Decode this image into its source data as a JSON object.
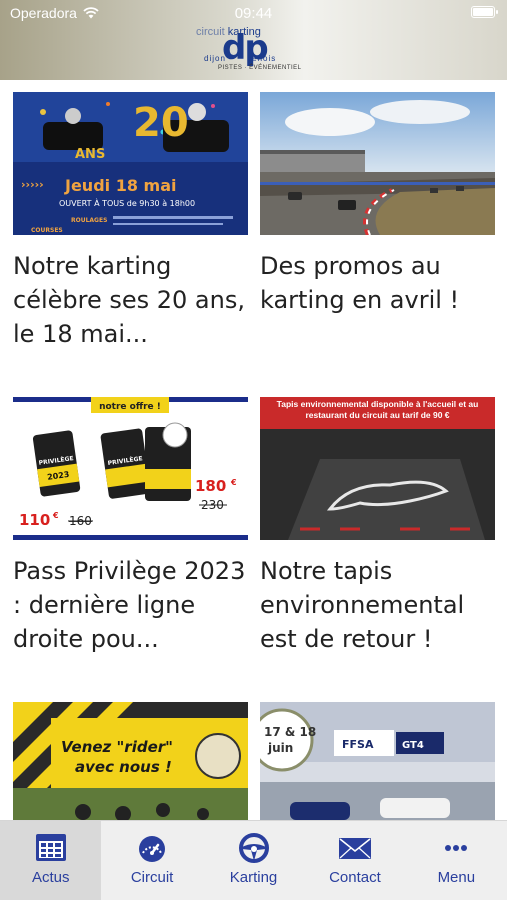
{
  "status_bar": {
    "carrier": "Operadora",
    "time": "09:44"
  },
  "logo": {
    "top_text_left": "circuit",
    "top_text_right": "karting",
    "monogram": "dp",
    "line_left": "dijon",
    "line_right": "renois",
    "tagline": "PISTES · ÉVÉNEMENTIEL"
  },
  "articles": [
    {
      "title": "Notre karting célèbre ses 20 ans, le 18 mai...",
      "image": {
        "big_text": "20",
        "ans_text": "ANS",
        "date_text": "Jeudi 18 mai",
        "hours_text": "OUVERT À TOUS de 9h30 à 18h00",
        "roulages": "ROULAGES",
        "courses": "COURSES"
      }
    },
    {
      "title": "Des promos au karting en avril !"
    },
    {
      "title": "Pass Privilège 2023 : dernière ligne droite pou...",
      "image": {
        "banner": "notre offre !",
        "price_new_1": "110",
        "price_old_1": "160",
        "price_new_2": "180",
        "price_old_2": "230",
        "currency": "€",
        "card_text": "PRIVILÈGE",
        "card_year": "2023"
      }
    },
    {
      "title": "Notre tapis environnemental est de retour !",
      "image": {
        "banner": "Tapis environnemental disponible à l'accueil et au restaurant du circuit au tarif de 90 €"
      }
    },
    {
      "title": "",
      "image": {
        "headline_1": "Venez \"rider\"",
        "headline_2": "avec nous !"
      }
    },
    {
      "title": "",
      "image": {
        "date_1": "17 & 18",
        "date_2": "juin",
        "badge": "FFSA",
        "badge2": "GT",
        "badge3": "GT4"
      }
    }
  ],
  "tabs": [
    {
      "label": "Actus",
      "icon": "calendar-grid-icon",
      "active": true
    },
    {
      "label": "Circuit",
      "icon": "speedometer-icon",
      "active": false
    },
    {
      "label": "Karting",
      "icon": "steering-wheel-icon",
      "active": false
    },
    {
      "label": "Contact",
      "icon": "envelope-icon",
      "active": false
    },
    {
      "label": "Menu",
      "icon": "more-dots-icon",
      "active": false
    }
  ],
  "colors": {
    "accent": "#2a3f9e",
    "tab_active_bg": "#d9d9d9",
    "tabbar_bg": "#efefef"
  }
}
